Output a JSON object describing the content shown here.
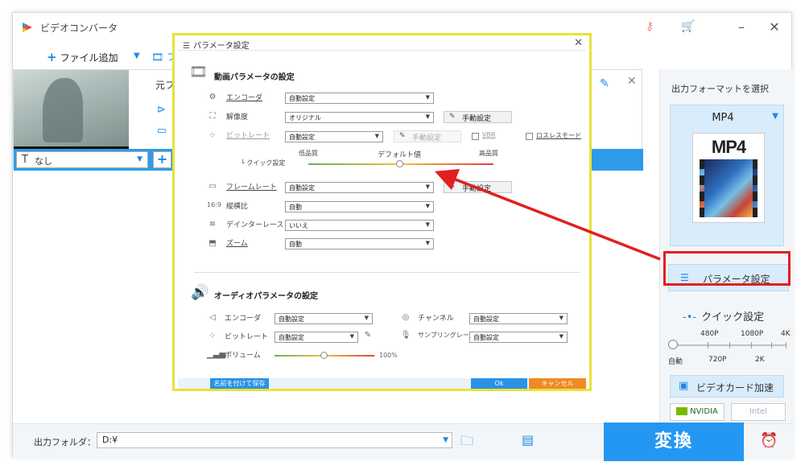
{
  "app": {
    "title": "ビデオコンバータ"
  },
  "toolbar": {
    "add_file_label": "ファイル追加",
    "next_label": "フ"
  },
  "file": {
    "source_label": "元フ",
    "subtitle_value": "なし"
  },
  "right_panel": {
    "format_title": "出力フォーマットを選択",
    "format_name": "MP4",
    "format_image_text": "MP4",
    "param_button_label": "パラメータ設定",
    "quick_title": "クイック設定",
    "quick_top_labels": [
      "480P",
      "1080P",
      "4K"
    ],
    "quick_bottom_labels": [
      "自動",
      "720P",
      "2K"
    ],
    "gpu_button_label": "ビデオカード加速",
    "nvidia_label": "NVIDIA",
    "intel_label": "Intel"
  },
  "bottom": {
    "output_folder_label": "出力フォルダ：",
    "output_folder_value": "D:¥",
    "convert_label": "変換"
  },
  "dialog": {
    "title": "パラメータ設定",
    "video_section_title": "動画パラメータの設定",
    "encoder_label": "エンコーダ",
    "encoder_value": "自動設定",
    "resolution_label": "解像度",
    "resolution_value": "オリジナル",
    "manual_label": "手動設定",
    "bitrate_label": "ビットレート",
    "bitrate_value": "自動設定",
    "vbr_label": "VBR",
    "lossless_label": "ロスレスモード",
    "quick_label": "クイック設定",
    "quality_low": "低品質",
    "quality_default": "デフォルト値",
    "quality_high": "高品質",
    "framerate_label": "フレームレート",
    "framerate_value": "自動設定",
    "aspect_label": "縦横比",
    "aspect_value": "自動",
    "deinterlace_label": "デインターレース",
    "deinterlace_value": "いいえ",
    "zoom_label": "ズーム",
    "zoom_value": "自動",
    "audio_section_title": "オーディオパラメータの設定",
    "a_encoder_label": "エンコーダ",
    "a_encoder_value": "自動設定",
    "channel_label": "チャンネル",
    "channel_value": "自動設定",
    "a_bitrate_label": "ビットレート",
    "a_bitrate_value": "自動設定",
    "sampling_label": "サンプリングレート",
    "sampling_value": "自動設定",
    "volume_label": "ボリューム",
    "volume_value": "100%",
    "save_as_label": "名前を付けて保存",
    "ok_label": "Ok",
    "cancel_label": "キャンセル"
  },
  "colors": {
    "accent": "#2497f3",
    "highlight_box": "#e02020",
    "dialog_border": "#e8e23a"
  }
}
